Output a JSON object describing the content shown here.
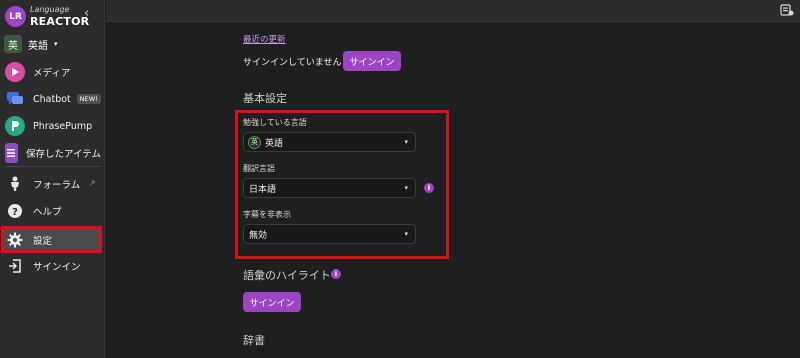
{
  "app": {
    "logo_mark": "LR",
    "logo_small": "Language",
    "logo_big": "REACTOR",
    "collapse_glyph": "‹"
  },
  "sidebar": {
    "language_badge": "英",
    "language_label": "英語",
    "caret": "▾",
    "items": [
      {
        "label": "メディア",
        "icon": "play-icon",
        "color": "#d94fa8"
      },
      {
        "label": "Chatbot",
        "icon": "chat-icon",
        "color": "#3a6de0",
        "badge": "NEW!"
      },
      {
        "label": "PhrasePump",
        "icon": "phrasepump-icon",
        "color": "#26a88f"
      },
      {
        "label": "保存したアイテム",
        "icon": "list-icon",
        "color": "#8a4bc4"
      },
      {
        "label": "フォーラム",
        "icon": "person-icon",
        "external_glyph": "↗"
      },
      {
        "label": "ヘルプ",
        "icon": "question-icon"
      },
      {
        "label": "設定",
        "icon": "gear-icon",
        "active": true
      },
      {
        "label": "サインイン",
        "icon": "signin-icon"
      }
    ]
  },
  "main": {
    "recent_updates_link": "最近の更新",
    "signin_status": "サインインしていません",
    "signin_button": "サインイン",
    "basic_settings_title": "基本設定",
    "study_language": {
      "label": "勉強している言語",
      "badge": "英",
      "value": "英語"
    },
    "translation_language": {
      "label": "翻訳言語",
      "value": "日本語"
    },
    "subtitles_hide": {
      "label": "字幕を非表示",
      "value": "無効"
    },
    "vocab_highlight_title": "語彙のハイライト",
    "vocab_signin_button": "サインイン",
    "dictionary_title": "辞書",
    "info_glyph": "i",
    "select_caret": "▾"
  },
  "colors": {
    "accent_purple": "#9d45c3",
    "highlight_red": "#d3121a",
    "sidebar_bg": "#2c2c2e",
    "content_bg": "#1f1f21"
  }
}
